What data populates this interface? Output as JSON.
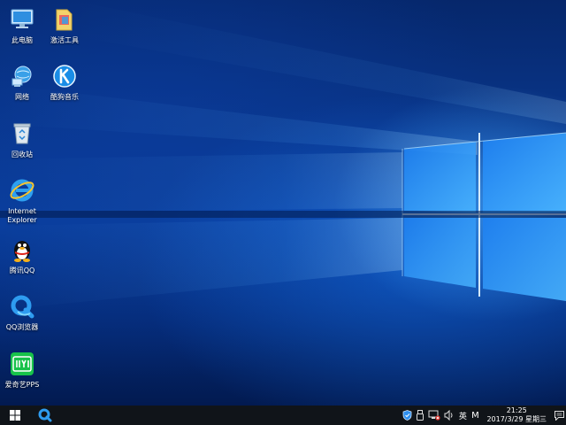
{
  "desktop": {
    "icons": [
      {
        "id": "this-pc",
        "label": "此电脑",
        "icon": "computer-icon"
      },
      {
        "id": "activation-tool",
        "label": "激活工具",
        "icon": "folder-icon"
      },
      {
        "id": "network",
        "label": "网络",
        "icon": "network-icon"
      },
      {
        "id": "kugou-music",
        "label": "酷狗音乐",
        "icon": "kugou-icon"
      },
      {
        "id": "recycle-bin",
        "label": "回收站",
        "icon": "recycle-bin-icon"
      },
      {
        "id": "internet-explorer",
        "label": "Internet Explorer",
        "icon": "ie-icon"
      },
      {
        "id": "tencent-qq",
        "label": "腾讯QQ",
        "icon": "qq-penguin-icon"
      },
      {
        "id": "qq-browser",
        "label": "QQ浏览器",
        "icon": "qq-browser-icon"
      },
      {
        "id": "iqiyi-pps",
        "label": "爱奇艺PPS",
        "icon": "iqiyi-icon"
      }
    ]
  },
  "taskbar": {
    "start_icon": "windows-logo-icon",
    "pinned": [
      {
        "name": "qq-browser-taskbar",
        "icon": "qq-browser-icon"
      }
    ],
    "tray": {
      "icons": [
        "shield-icon",
        "usb-icon",
        "network-status-icon",
        "volume-icon"
      ],
      "ime_label": "英",
      "ime_mode": "M",
      "time": "21:25",
      "date": "2017/3/29 星期三"
    }
  },
  "colors": {
    "taskbar_bg": "#101419",
    "desktop_blue": "#0a3f9d",
    "highlight": "#6fd0ff"
  }
}
